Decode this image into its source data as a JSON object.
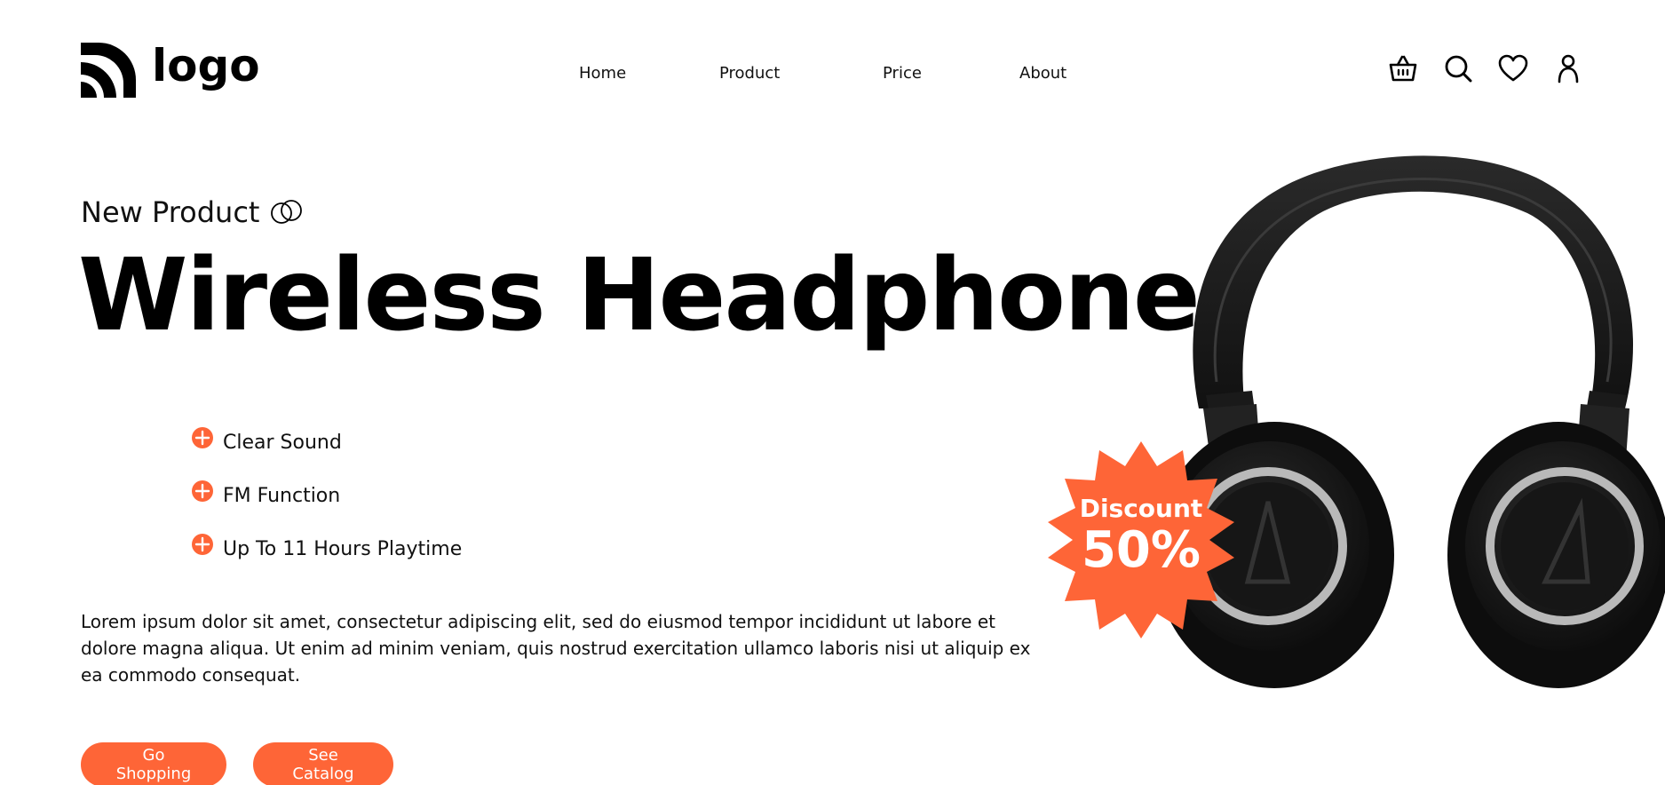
{
  "header": {
    "logo_text": "logo",
    "nav": [
      "Home",
      "Product",
      "Price",
      "About"
    ],
    "icons": [
      "basket-icon",
      "search-icon",
      "heart-icon",
      "user-icon"
    ]
  },
  "hero": {
    "eyebrow": "New Product",
    "title": "Wireless Headphone",
    "features": [
      "Clear Sound",
      "FM Function",
      "Up To 11 Hours Playtime"
    ],
    "description": "Lorem ipsum dolor sit amet, consectetur adipiscing elit, sed do eiusmod tempor incididunt ut labore et dolore magna aliqua. Ut enim ad minim veniam, quis nostrud exercitation ullamco laboris nisi ut aliquip ex ea commodo consequat.",
    "buttons": {
      "primary": "Go Shopping",
      "secondary": "See Catalog"
    }
  },
  "badge": {
    "label": "Discount",
    "value": "50%"
  },
  "colors": {
    "accent": "#fe6537",
    "text": "#000000",
    "background": "#ffffff"
  }
}
